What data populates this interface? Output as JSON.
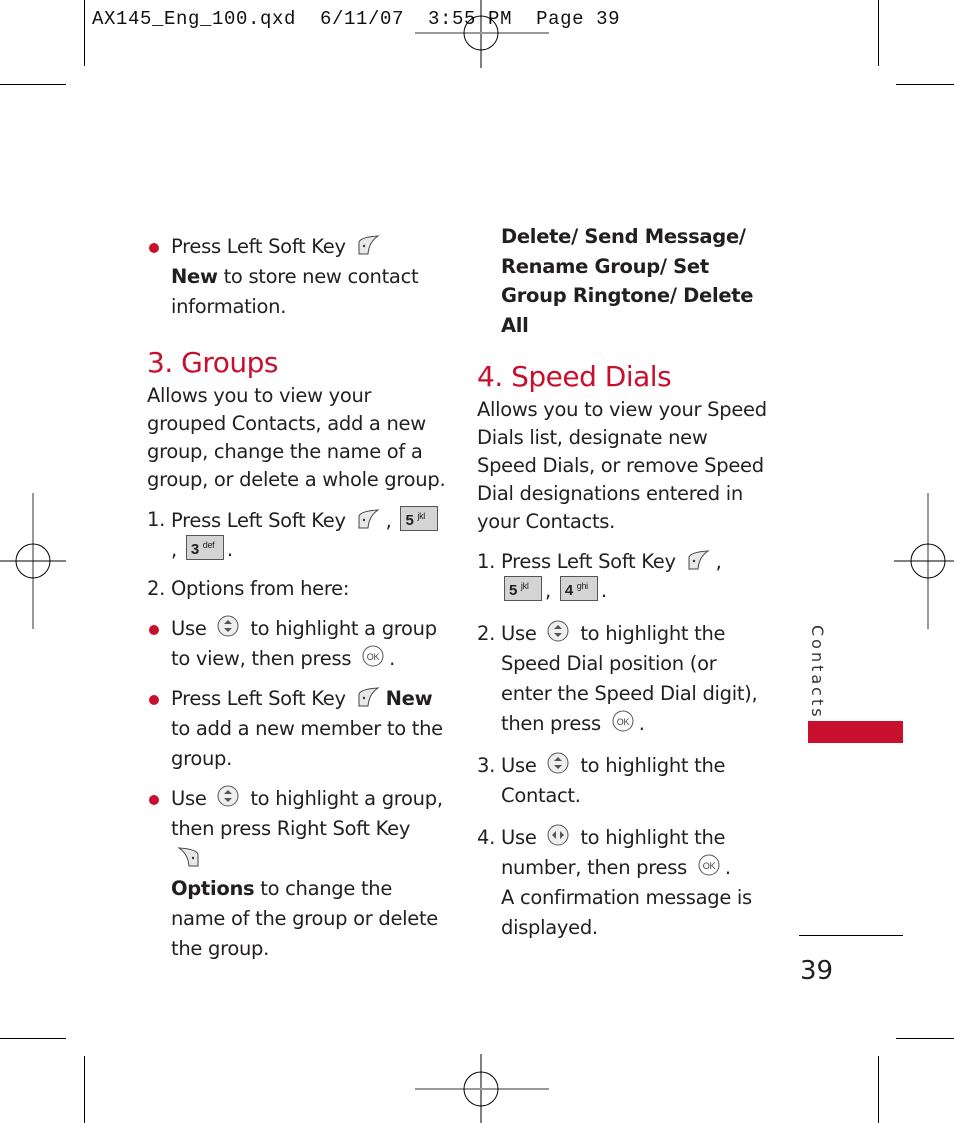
{
  "slug": "AX145_Eng_100.qxd  6/11/07  3:55 PM  Page 39",
  "left_column": {
    "intro_bullet": {
      "pre": "Press Left Soft Key",
      "bold": "New",
      "post": " to store new contact information."
    },
    "section3": {
      "title": "3. Groups",
      "description": "Allows you to view your grouped Contacts, add a new group, change the name of a group, or delete a whole group.",
      "step1": {
        "num": "1.",
        "text": "Press Left Soft Key",
        "keys": [
          "5",
          "jkl",
          "3",
          "def"
        ]
      },
      "step2": {
        "num": "2.",
        "text": "Options from here:"
      },
      "bullets": [
        {
          "pre": "Use",
          "mid": " to highlight a group to view, then press",
          "post": "."
        },
        {
          "pre": "Press Left Soft Key",
          "bold": "New",
          "post": " to add a  new member to the group."
        },
        {
          "pre": "Use",
          "mid": " to highlight a group, then press Right Soft Key",
          "bold": "Options",
          "post": " to change the name of the group or delete the group."
        }
      ]
    }
  },
  "right_column": {
    "options_list": "Delete/ Send Message/ Rename Group/ Set Group Ringtone/ Delete All",
    "section4": {
      "title": "4. Speed Dials",
      "description": "Allows you to view your Speed Dials list, designate new Speed Dials, or remove Speed Dial designations entered in your Contacts.",
      "step1": {
        "num": "1.",
        "text": "Press Left Soft Key",
        "keys": [
          "5",
          "jkl",
          "4",
          "ghi"
        ]
      },
      "step2": {
        "num": "2.",
        "pre": "Use",
        "post": " to highlight the Speed Dial position (or enter the Speed Dial digit), then press",
        "end": "."
      },
      "step3": {
        "num": "3.",
        "pre": "Use",
        "post": " to highlight the Contact."
      },
      "step4": {
        "num": "4.",
        "pre": "Use",
        "post": " to highlight the number, then press",
        "end": ".",
        "extra": "A confirmation message is displayed."
      }
    }
  },
  "side_tab": {
    "label": "Contacts",
    "color": "#c8102e"
  },
  "page_number": "39",
  "colors": {
    "accent": "#c8102e",
    "text": "#231f20"
  }
}
